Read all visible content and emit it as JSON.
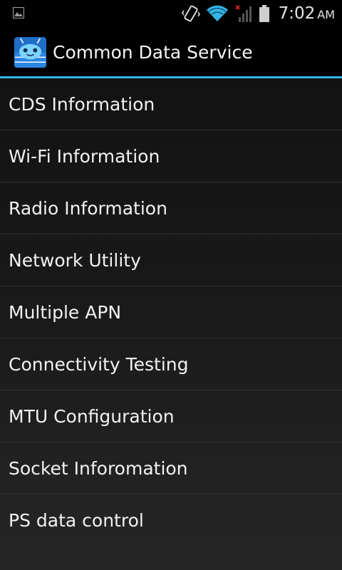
{
  "status_bar": {
    "time": "7:02",
    "ampm": "AM",
    "icons": [
      "image-notification-icon",
      "vibrate-icon",
      "wifi-icon",
      "no-signal-icon",
      "battery-icon"
    ]
  },
  "action_bar": {
    "title": "Common Data Service",
    "icon": "android-app-icon"
  },
  "colors": {
    "accent": "#33b5e5",
    "background": "#101010",
    "text": "#f2f2f2"
  },
  "menu": {
    "items": [
      {
        "label": "CDS Information"
      },
      {
        "label": "Wi-Fi Information"
      },
      {
        "label": "Radio Information"
      },
      {
        "label": "Network Utility"
      },
      {
        "label": "Multiple APN"
      },
      {
        "label": "Connectivity Testing"
      },
      {
        "label": "MTU Configuration"
      },
      {
        "label": "Socket Inforomation"
      },
      {
        "label": "PS data control"
      }
    ]
  }
}
